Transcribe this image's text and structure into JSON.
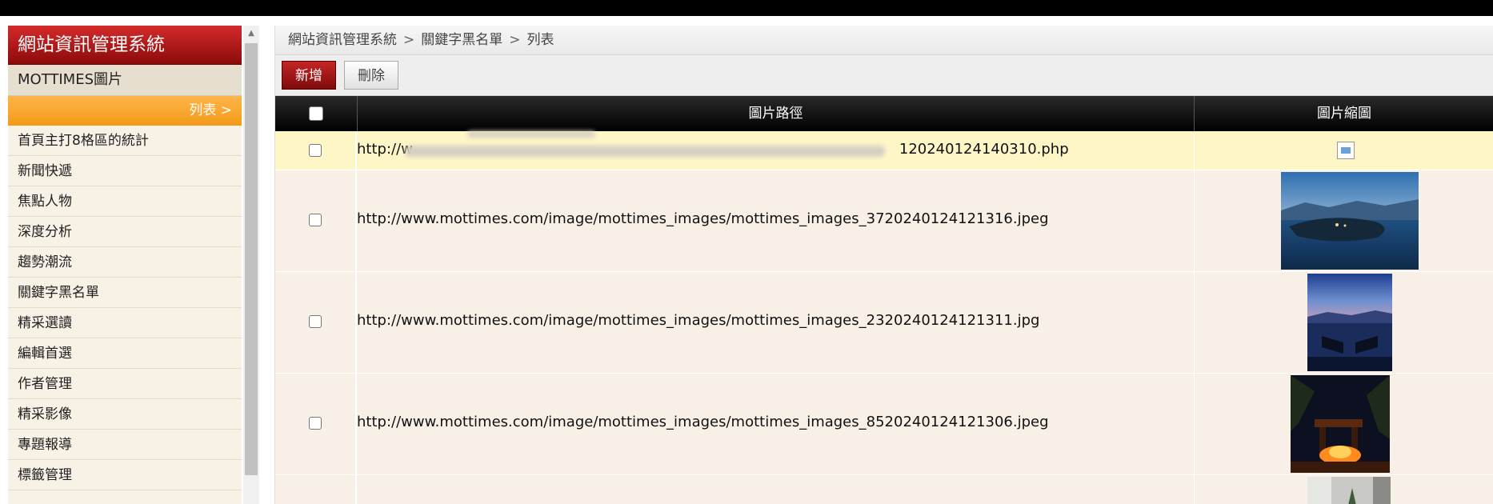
{
  "sidebar": {
    "title": "網站資訊管理系統",
    "section": "MOTTIMES圖片",
    "sub_link": "列表 >",
    "items": [
      "首頁主打8格區的統計",
      "新聞快遞",
      "焦點人物",
      "深度分析",
      "趨勢潮流",
      "關鍵字黑名單",
      "精采選讀",
      "編輯首選",
      "作者管理",
      "精采影像",
      "專題報導",
      "標籤管理"
    ]
  },
  "breadcrumb": [
    "網站資訊管理系統",
    "關鍵字黑名單",
    "列表"
  ],
  "breadcrumb_sep": ">",
  "toolbar": {
    "add_label": "新增",
    "delete_label": "刪除"
  },
  "table": {
    "headers": {
      "path": "圖片路徑",
      "thumbnail": "圖片縮圖"
    },
    "rows": [
      {
        "path_prefix": "http://w",
        "path_suffix": "120240124140310.php",
        "thumbnail": "broken-image-icon"
      },
      {
        "path": "http://www.mottimes.com/image/mottimes_images/mottimes_images_3720240124121316.jpeg",
        "thumbnail": "lake-island-dusk"
      },
      {
        "path": "http://www.mottimes.com/image/mottimes_images/mottimes_images_2320240124121311.jpg",
        "thumbnail": "lake-twilight-pier"
      },
      {
        "path": "http://www.mottimes.com/image/mottimes_images/mottimes_images_8520240124121306.jpeg",
        "thumbnail": "night-gate-fire"
      }
    ]
  },
  "colors": {
    "header_red": "#8c0a0a",
    "accent_orange": "#f29a18",
    "row_bg": "#f8f0e6",
    "row_highlight": "#fff6c8",
    "table_header": "#000000"
  }
}
